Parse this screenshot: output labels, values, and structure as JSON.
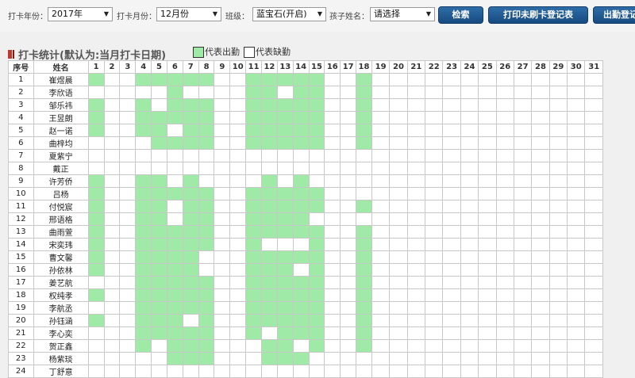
{
  "toolbar": {
    "year_label": "打卡年份：",
    "year_value": "2017年",
    "month_label": "打卡月份：",
    "month_value": "12月份",
    "class_label": "班级：",
    "class_value": "蓝宝石(开启)",
    "child_label": "孩子姓名：",
    "child_value": "请选择",
    "search_button": "检索",
    "print_button": "打印未刷卡登记表",
    "export_button": "出勤登记"
  },
  "section": {
    "title": "打卡统计(默认为:当月打卡日期)"
  },
  "legend": {
    "present": "代表出勤",
    "absent": "代表缺勤"
  },
  "colors": {
    "present": "#a0eaa8",
    "absent": "#ffffff",
    "button": "#1f5a94",
    "title_marker": "#c0392b"
  },
  "table": {
    "header_no": "序号",
    "header_name": "姓名",
    "days": [
      "1",
      "2",
      "3",
      "4",
      "5",
      "6",
      "7",
      "8",
      "9",
      "10",
      "11",
      "12",
      "13",
      "14",
      "15",
      "16",
      "17",
      "18",
      "19",
      "20",
      "21",
      "22",
      "23",
      "24",
      "25",
      "26",
      "27",
      "28",
      "29",
      "30",
      "31"
    ],
    "rows": [
      {
        "no": "1",
        "name": "崔煜晨",
        "present": [
          1,
          4,
          5,
          6,
          7,
          8,
          11,
          12,
          13,
          14,
          15,
          18
        ]
      },
      {
        "no": "2",
        "name": "李欣语",
        "present": [
          6,
          11,
          12,
          14,
          15,
          18
        ]
      },
      {
        "no": "3",
        "name": "邹乐祎",
        "present": [
          1,
          4,
          6,
          7,
          8,
          11,
          12,
          13,
          14,
          15,
          18
        ]
      },
      {
        "no": "4",
        "name": "王昱朗",
        "present": [
          1,
          4,
          5,
          6,
          7,
          8,
          11,
          12,
          13,
          14,
          15,
          18
        ]
      },
      {
        "no": "5",
        "name": "赵一诺",
        "present": [
          1,
          4,
          5,
          7,
          8,
          11,
          12,
          13,
          14,
          15,
          18
        ]
      },
      {
        "no": "6",
        "name": "曲梓均",
        "present": [
          5,
          6,
          7,
          8,
          11,
          12,
          13,
          14,
          15,
          18
        ]
      },
      {
        "no": "7",
        "name": "夏紫宁",
        "present": []
      },
      {
        "no": "8",
        "name": "戴正",
        "present": []
      },
      {
        "no": "9",
        "name": "许芳侨",
        "present": [
          1,
          4,
          5,
          7,
          12,
          14
        ]
      },
      {
        "no": "10",
        "name": "吕杨",
        "present": [
          1,
          4,
          5,
          6,
          7,
          8,
          11,
          12,
          13,
          14,
          15
        ]
      },
      {
        "no": "11",
        "name": "付悦宸",
        "present": [
          1,
          4,
          5,
          7,
          8,
          11,
          12,
          13,
          14,
          15,
          18
        ]
      },
      {
        "no": "12",
        "name": "邢语格",
        "present": [
          1,
          4,
          5,
          7,
          8,
          11,
          12,
          13,
          14
        ]
      },
      {
        "no": "13",
        "name": "曲雨萱",
        "present": [
          1,
          4,
          5,
          6,
          7,
          8,
          11,
          12,
          13,
          14,
          15,
          18
        ]
      },
      {
        "no": "14",
        "name": "宋奕玮",
        "present": [
          1,
          4,
          5,
          6,
          7,
          8,
          11,
          15,
          18
        ]
      },
      {
        "no": "15",
        "name": "曹文馨",
        "present": [
          1,
          4,
          5,
          6,
          7,
          11,
          12,
          13,
          14,
          15,
          18
        ]
      },
      {
        "no": "16",
        "name": "孙依林",
        "present": [
          1,
          4,
          5,
          6,
          7,
          11,
          12,
          13,
          15,
          18
        ]
      },
      {
        "no": "17",
        "name": "姜艺航",
        "present": [
          4,
          5,
          6,
          7,
          8,
          11,
          12,
          13,
          14,
          15,
          18
        ]
      },
      {
        "no": "18",
        "name": "权纯孝",
        "present": [
          1,
          4,
          5,
          6,
          7,
          8,
          11,
          12,
          13,
          14,
          15,
          18
        ]
      },
      {
        "no": "19",
        "name": "李航丞",
        "present": [
          4,
          5,
          6,
          7,
          8,
          11,
          12,
          13,
          14,
          15,
          18
        ]
      },
      {
        "no": "20",
        "name": "孙钰涵",
        "present": [
          1,
          4,
          5,
          6,
          8,
          11,
          12,
          13,
          14,
          15,
          18
        ]
      },
      {
        "no": "21",
        "name": "李心奕",
        "present": [
          4,
          5,
          6,
          7,
          8,
          11,
          13,
          14,
          15,
          18
        ]
      },
      {
        "no": "22",
        "name": "贺正鑫",
        "present": [
          4,
          6,
          7,
          8,
          12,
          13,
          15,
          18
        ]
      },
      {
        "no": "23",
        "name": "杨紫琰",
        "present": [
          6,
          7,
          8,
          12,
          13,
          14
        ]
      },
      {
        "no": "24",
        "name": "丁舒意",
        "present": []
      }
    ]
  }
}
